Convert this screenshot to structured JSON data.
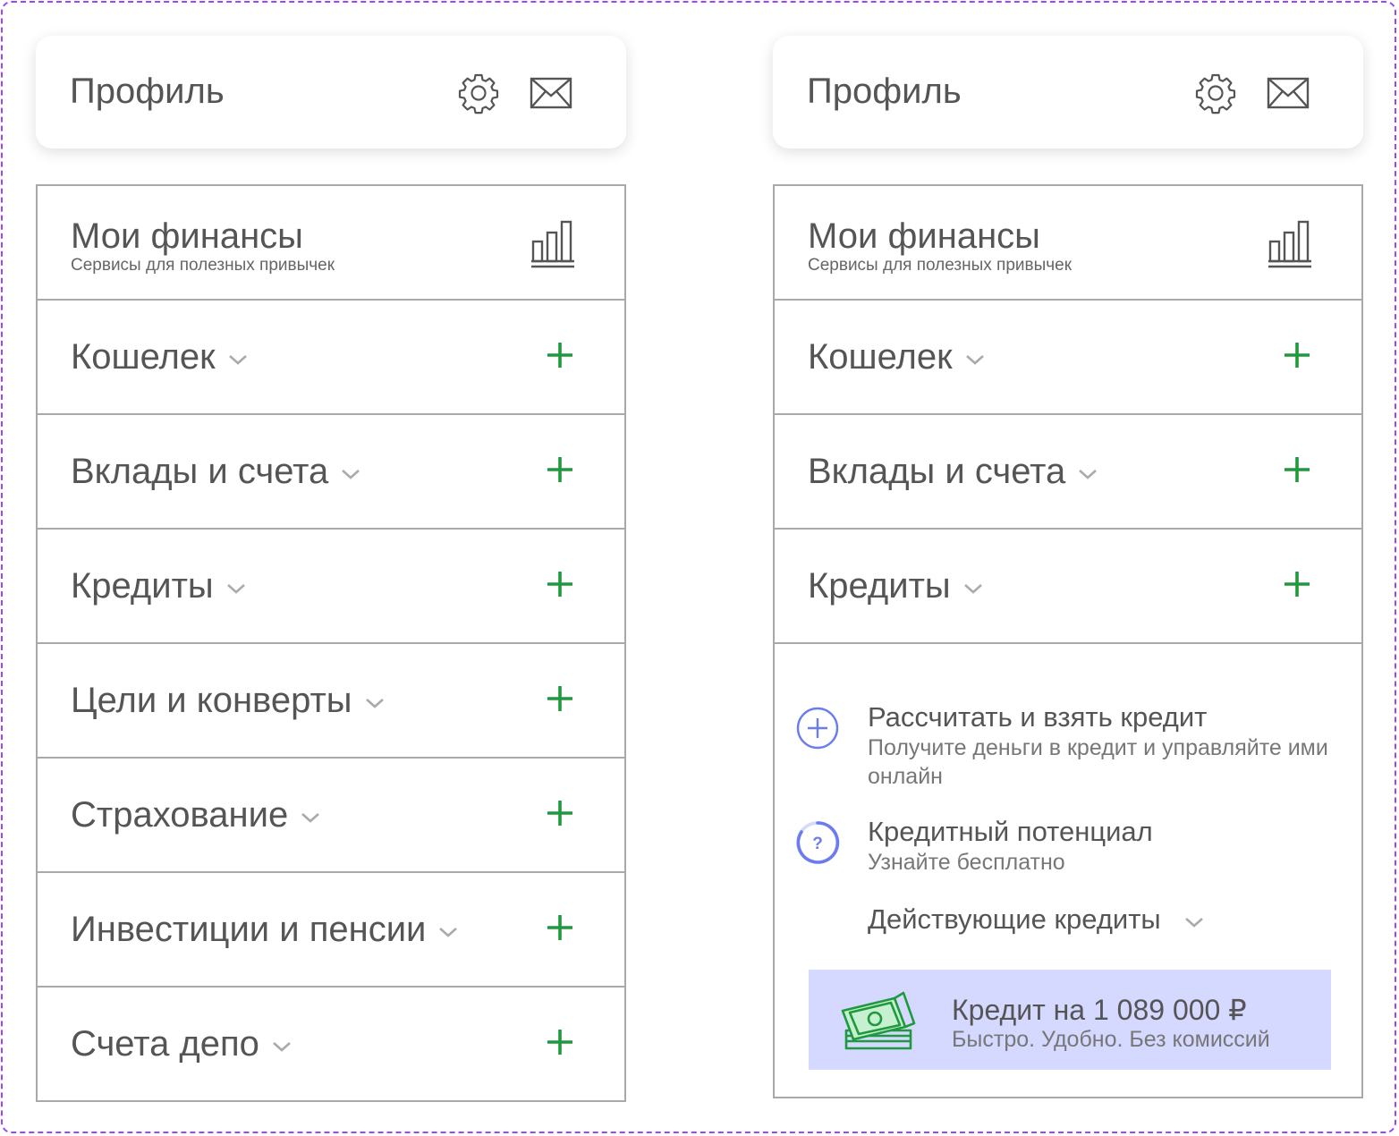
{
  "profile": {
    "title": "Профиль",
    "icons": [
      "gear-icon",
      "mail-icon"
    ]
  },
  "finances": {
    "title": "Мои финансы",
    "subtitle": "Сервисы для полезных привычек",
    "icon": "bar-chart-icon"
  },
  "left_items": [
    {
      "label": "Кошелек"
    },
    {
      "label": "Вклады и счета"
    },
    {
      "label": "Кредиты"
    },
    {
      "label": "Цели и конверты"
    },
    {
      "label": "Страхование"
    },
    {
      "label": "Инвестиции и пенсии"
    },
    {
      "label": "Счета депо"
    }
  ],
  "right_items": [
    {
      "label": "Кошелек"
    },
    {
      "label": "Вклады и счета"
    },
    {
      "label": "Кредиты"
    }
  ],
  "credit_section": {
    "calc": {
      "title": "Рассчитать и взять кредит",
      "desc": "Получите деньги в кредит и управляйте ими онлайн"
    },
    "potential": {
      "title": "Кредитный потенциал",
      "desc": "Узнайте бесплатно"
    },
    "active": "Действующие кредиты",
    "promo": {
      "title": "Кредит на 1 089 000 ₽",
      "subtitle": "Быстро. Удобно. Без комиссий"
    }
  },
  "colors": {
    "accent_green": "#1e9a3c",
    "accent_blue": "#6b7cf0",
    "promo_bg": "#d5d8ff",
    "frame": "#9747ff"
  }
}
